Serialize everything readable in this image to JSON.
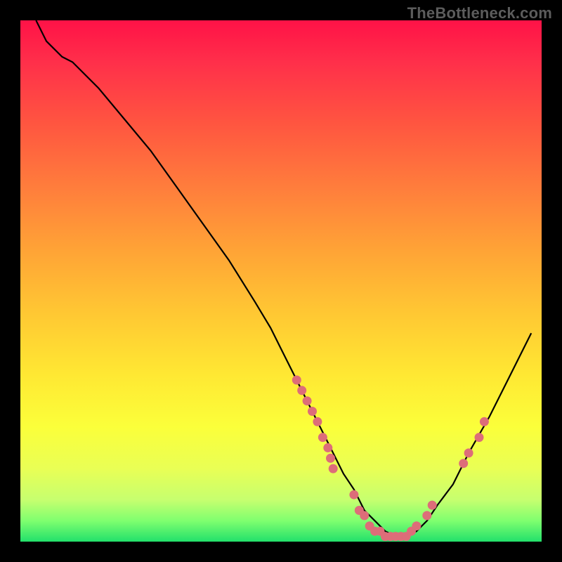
{
  "watermark": "TheBottleneck.com",
  "chart_data": {
    "type": "line",
    "title": "",
    "xlabel": "",
    "ylabel": "",
    "xlim": [
      0,
      100
    ],
    "ylim": [
      0,
      100
    ],
    "grid": false,
    "legend": false,
    "series": [
      {
        "name": "curve",
        "x": [
          3,
          5,
          8,
          10,
          15,
          20,
          25,
          30,
          35,
          40,
          45,
          48,
          50,
          53,
          56,
          58,
          60,
          62,
          64,
          66,
          68,
          70,
          72,
          74,
          76,
          78,
          80,
          83,
          86,
          90,
          94,
          98
        ],
        "y": [
          100,
          96,
          93,
          92,
          87,
          81,
          75,
          68,
          61,
          54,
          46,
          41,
          37,
          31,
          25,
          21,
          17,
          13,
          10,
          6,
          4,
          2,
          1,
          1,
          2,
          4,
          7,
          11,
          17,
          24,
          32,
          40
        ]
      }
    ],
    "scatter_points": [
      {
        "x": 53,
        "y": 31
      },
      {
        "x": 54,
        "y": 29
      },
      {
        "x": 55,
        "y": 27
      },
      {
        "x": 56,
        "y": 25
      },
      {
        "x": 57,
        "y": 23
      },
      {
        "x": 58,
        "y": 20
      },
      {
        "x": 59,
        "y": 18
      },
      {
        "x": 59.5,
        "y": 16
      },
      {
        "x": 60,
        "y": 14
      },
      {
        "x": 64,
        "y": 9
      },
      {
        "x": 65,
        "y": 6
      },
      {
        "x": 66,
        "y": 5
      },
      {
        "x": 67,
        "y": 3
      },
      {
        "x": 68,
        "y": 2
      },
      {
        "x": 69,
        "y": 2
      },
      {
        "x": 70,
        "y": 1
      },
      {
        "x": 71,
        "y": 1
      },
      {
        "x": 72,
        "y": 1
      },
      {
        "x": 73,
        "y": 1
      },
      {
        "x": 74,
        "y": 1
      },
      {
        "x": 75,
        "y": 2
      },
      {
        "x": 76,
        "y": 3
      },
      {
        "x": 78,
        "y": 5
      },
      {
        "x": 79,
        "y": 7
      },
      {
        "x": 85,
        "y": 15
      },
      {
        "x": 86,
        "y": 17
      },
      {
        "x": 88,
        "y": 20
      },
      {
        "x": 89,
        "y": 23
      }
    ],
    "background_gradient": {
      "top": "#ff1247",
      "mid": "#ffe833",
      "bottom": "#22e06b"
    }
  }
}
